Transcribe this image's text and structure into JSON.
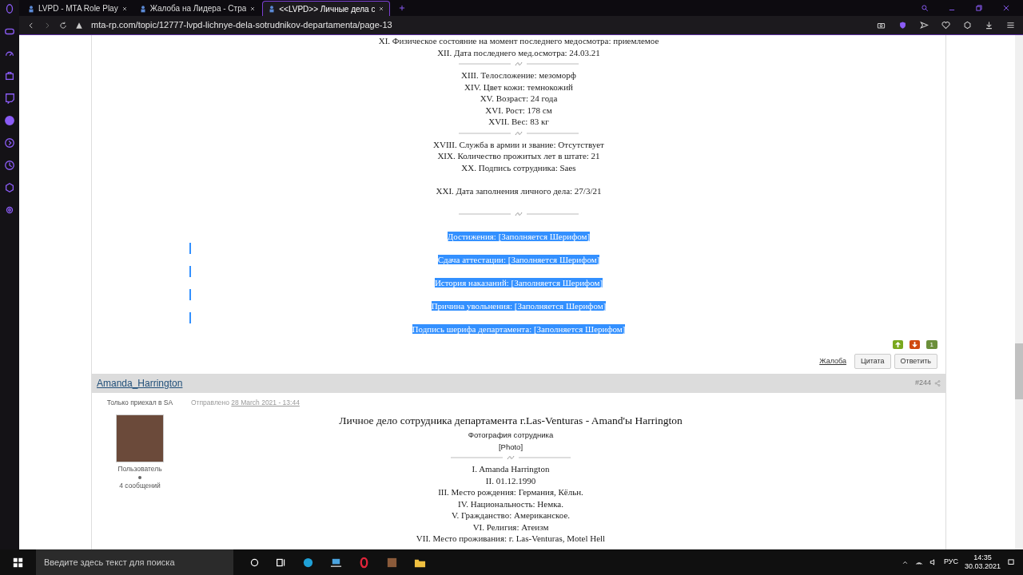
{
  "browser": {
    "tabs": [
      {
        "title": "LVPD - MTA Role Play",
        "selected": false
      },
      {
        "title": "Жалоба на Лидера - Стра",
        "selected": false
      },
      {
        "title": "<<LVPD>> Личные дела с",
        "selected": true
      }
    ],
    "url": "mta-rp.com/topic/12777-lvpd-lichnye-dela-sotrudnikov-departamenta/page-13"
  },
  "post_1": {
    "lines": [
      {
        "kind": "text",
        "text": "XI. Физическое состояние на момент последнего медосмотра: приемлемое",
        "selected": false
      },
      {
        "kind": "text",
        "text": "XII. Дата последнего мед.осмотра: 24.03.21",
        "selected": false
      },
      {
        "kind": "divider",
        "selected": false
      },
      {
        "kind": "text",
        "text": "XIII. Телосложение: мезоморф",
        "selected": false
      },
      {
        "kind": "text",
        "text": "XIV. Цвет кожи: темнокожий",
        "selected": false
      },
      {
        "kind": "text",
        "text": "XV. Возраст: 24 года",
        "selected": false
      },
      {
        "kind": "text",
        "text": "XVI. Рост: 178 см",
        "selected": false
      },
      {
        "kind": "text",
        "text": "XVII. Вес: 83 кг",
        "selected": false
      },
      {
        "kind": "divider",
        "selected": false
      },
      {
        "kind": "text",
        "text": "XVIII. Служба в армии и звание: Отсутствует",
        "selected": false
      },
      {
        "kind": "text",
        "text": "XIX. Количество прожитых лет в штате: 21",
        "selected": false
      },
      {
        "kind": "text",
        "text": "XX. Подпись сотрудника: Saes",
        "selected": false
      },
      {
        "kind": "gap",
        "selected": false
      },
      {
        "kind": "text",
        "text": "XXI. Дата заполнения личного дела: 27/3/21",
        "selected": false
      },
      {
        "kind": "gap",
        "selected": false
      },
      {
        "kind": "divider",
        "selected": false
      },
      {
        "kind": "gap",
        "selected": false
      },
      {
        "kind": "text",
        "text": "Достижения: [Заполняется Шерифом]",
        "selected": true
      },
      {
        "kind": "gap",
        "selected": true
      },
      {
        "kind": "text",
        "text": "Сдача аттестации: [Заполняется Шерифом]",
        "selected": true
      },
      {
        "kind": "gap",
        "selected": true
      },
      {
        "kind": "text",
        "text": "История наказаний: [Заполняется Шерифом]",
        "selected": true
      },
      {
        "kind": "gap",
        "selected": true
      },
      {
        "kind": "text",
        "text": "Причина увольнения: [Заполняется Шерифом]",
        "selected": true
      },
      {
        "kind": "gap",
        "selected": true
      },
      {
        "kind": "text",
        "text": "Подпись шерифа департамента: [Заполняется Шерифом]",
        "selected": true
      }
    ],
    "reputation": "1",
    "buttons": [
      {
        "kind": "link",
        "label": "Жалоба"
      },
      {
        "kind": "button",
        "label": "Цитата"
      },
      {
        "kind": "button",
        "label": "Ответить"
      }
    ]
  },
  "post_2": {
    "author": "Amanda_Harrington",
    "number": "#244",
    "rank_title": "Только приехал в SA",
    "group": "Пользователь",
    "post_count": "4 сообщений",
    "posted_label": "Отправлено",
    "date": "28 March 2021 - 13:44",
    "title": "Личное дело сотрудника департамента г.Las-Venturas - Amand'ы Harrington",
    "lines": [
      {
        "kind": "sub",
        "text": "Фотография сотрудника"
      },
      {
        "kind": "sub",
        "text": "[Photo]"
      },
      {
        "kind": "divider"
      },
      {
        "kind": "text",
        "text": "I.  Amanda Harrington"
      },
      {
        "kind": "text",
        "text": "II. 01.12.1990"
      },
      {
        "kind": "text",
        "text": "III. Место рождения:  Германия, Кёльн."
      },
      {
        "kind": "text",
        "text": "IV. Национальность:  Немка."
      },
      {
        "kind": "text",
        "text": "V. Гражданство:  Американское."
      },
      {
        "kind": "text",
        "text": "VI. Религия:  Атеизм"
      },
      {
        "kind": "text",
        "text": "VII. Место проживания: г. Las-Venturas, Motel Hell"
      }
    ]
  },
  "taskbar": {
    "search_placeholder": "Введите здесь текст для поиска",
    "language": "РУС",
    "time": "14:35",
    "date": "30.03.2021"
  }
}
